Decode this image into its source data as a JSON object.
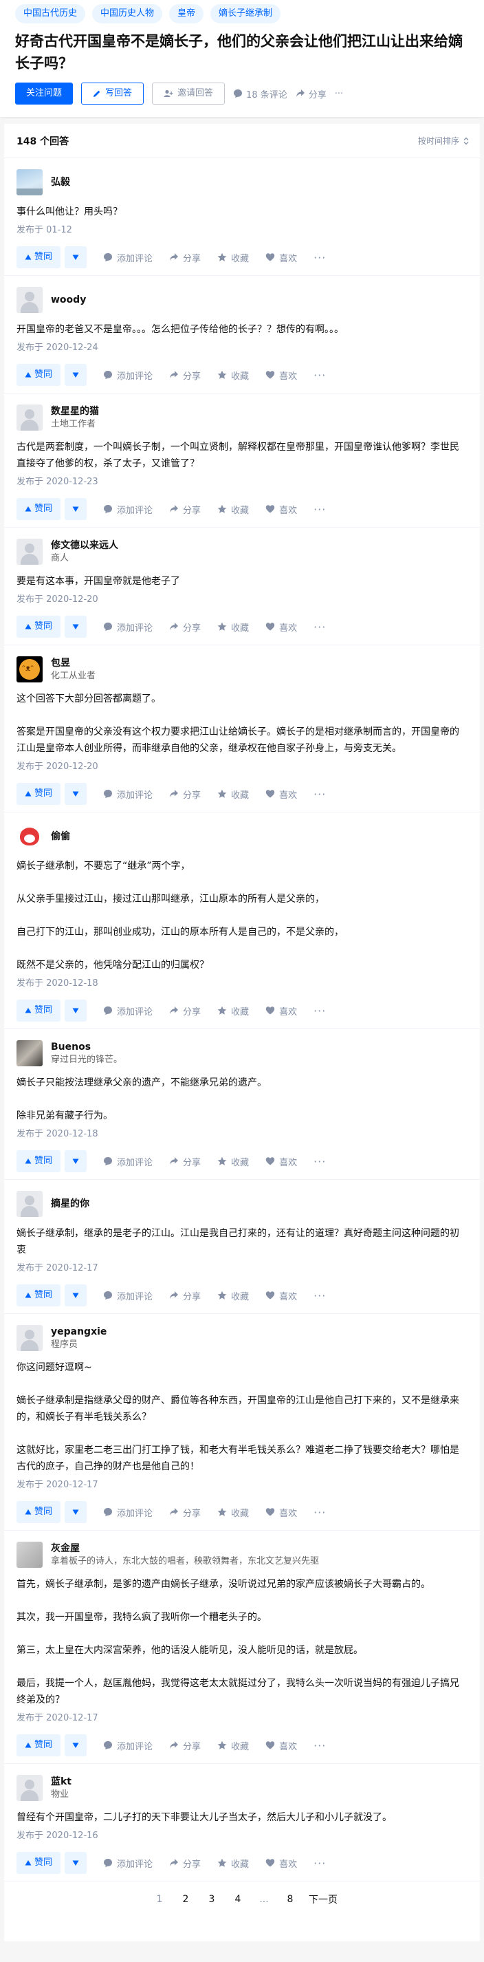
{
  "question": {
    "topics": [
      "中国古代历史",
      "中国历史人物",
      "皇帝",
      "嫡长子继承制"
    ],
    "title": "好奇古代开国皇帝不是嫡长子，他们的父亲会让他们把江山让出来给嫡长子吗？",
    "follow_label": "关注问题",
    "write_label": "写回答",
    "invite_label": "邀请回答",
    "comments_label": "18 条评论",
    "share_label": "分享",
    "more_label": "···"
  },
  "answer_list": {
    "count_label": "148 个回答",
    "sort_label": "按时间排序"
  },
  "action_labels": {
    "vote_up": "赞同",
    "comment": "添加评论",
    "share": "分享",
    "collect": "收藏",
    "like": "喜欢",
    "more": "···"
  },
  "answers": [
    {
      "author": "弘毅",
      "bio": "",
      "avatar": "sky",
      "paragraphs": [
        "事什么叫他让？用头吗？"
      ],
      "date": "发布于 01-12"
    },
    {
      "author": "woody",
      "bio": "",
      "avatar": "generic",
      "paragraphs": [
        "开国皇帝的老爸又不是皇帝。。。怎么把位子传给他的长子？？想传的有啊。。。"
      ],
      "date": "发布于 2020-12-24"
    },
    {
      "author": "数星星的猫",
      "bio": "土地工作者",
      "avatar": "generic",
      "paragraphs": [
        "古代是两套制度，一个叫嫡长子制，一个叫立贤制，解释权都在皇帝那里，开国皇帝谁认他爹啊？李世民直接夺了他爹的权，杀了太子，又谁管了？"
      ],
      "date": "发布于 2020-12-23"
    },
    {
      "author": "修文德以来远人",
      "bio": "商人",
      "avatar": "generic",
      "paragraphs": [
        "要是有这本事，开国皇帝就是他老子了"
      ],
      "date": "发布于 2020-12-20"
    },
    {
      "author": "包昱",
      "bio": "化工从业者",
      "avatar": "smile",
      "paragraphs": [
        "这个回答下大部分回答都离题了。",
        "答案是开国皇帝的父亲没有这个权力要求把江山让给嫡长子。嫡长子的是相对继承制而言的，开国皇帝的江山是皇帝本人创业所得，而非继承自他的父亲，继承权在他自家子孙身上，与旁支无关。"
      ],
      "date": "发布于 2020-12-20"
    },
    {
      "author": "偷偷",
      "bio": "",
      "avatar": "fox",
      "paragraphs": [
        "嫡长子继承制，不要忘了“继承”两个字，",
        "从父亲手里接过江山，接过江山那叫继承，江山原本的所有人是父亲的，",
        "自己打下的江山，那叫创业成功，江山的原本所有人是自己的，不是父亲的，",
        "既然不是父亲的，他凭啥分配江山的归属权？"
      ],
      "date": "发布于 2020-12-18"
    },
    {
      "author": "Buenos",
      "bio": "穿过日光的锋芒。",
      "avatar": "photo",
      "paragraphs": [
        "嫡长子只能按法理继承父亲的遗产，不能继承兄弟的遗产。",
        "除非兄弟有藏子行为。"
      ],
      "date": "发布于 2020-12-18"
    },
    {
      "author": "摘星的你",
      "bio": "",
      "avatar": "generic",
      "paragraphs": [
        "嫡长子继承制，继承的是老子的江山。江山是我自己打来的，还有让的道理？真好奇题主问这种问题的初衷"
      ],
      "date": "发布于 2020-12-17"
    },
    {
      "author": "yepangxie",
      "bio": "程序员",
      "avatar": "generic",
      "paragraphs": [
        "你这问题好逗啊~",
        "嫡长子继承制是指继承父母的财产、爵位等各种东西，开国皇帝的江山是他自己打下来的，又不是继承来的，和嫡长子有半毛钱关系么？",
        "这就好比，家里老二老三出门打工挣了钱，和老大有半毛钱关系么？难道老二挣了钱要交给老大？哪怕是古代的庶子，自己挣的财产也是他自己的！"
      ],
      "date": "发布于 2020-12-17"
    },
    {
      "author": "灰金屋",
      "bio": "拿着板子的诗人，东北大鼓的唱者，秧歌领舞者，东北文艺复兴先驱",
      "avatar": "gray",
      "paragraphs": [
        "首先，嫡长子继承制，是爹的遗产由嫡长子继承，没听说过兄弟的家产应该被嫡长子大哥霸占的。",
        "其次，我一开国皇帝，我特么疯了我听你一个糟老头子的。",
        "第三，太上皇在大内深宫荣养，他的话没人能听见，没人能听见的话，就是放屁。",
        "最后，我提一个人，赵匡胤他妈，我觉得这老太太就挺过分了，我特么头一次听说当妈的有强迫儿子搞兄终弟及的？"
      ],
      "date": "发布于 2020-12-17"
    },
    {
      "author": "蓝kt",
      "bio": "物业",
      "avatar": "generic",
      "paragraphs": [
        "曾经有个开国皇帝，二儿子打的天下非要让大儿子当太子，然后大儿子和小儿子就没了。"
      ],
      "date": "发布于 2020-12-16"
    }
  ],
  "pagination": {
    "pages": [
      "1",
      "2",
      "3",
      "4",
      "...",
      "8"
    ],
    "current": "1",
    "next_label": "下一页"
  }
}
